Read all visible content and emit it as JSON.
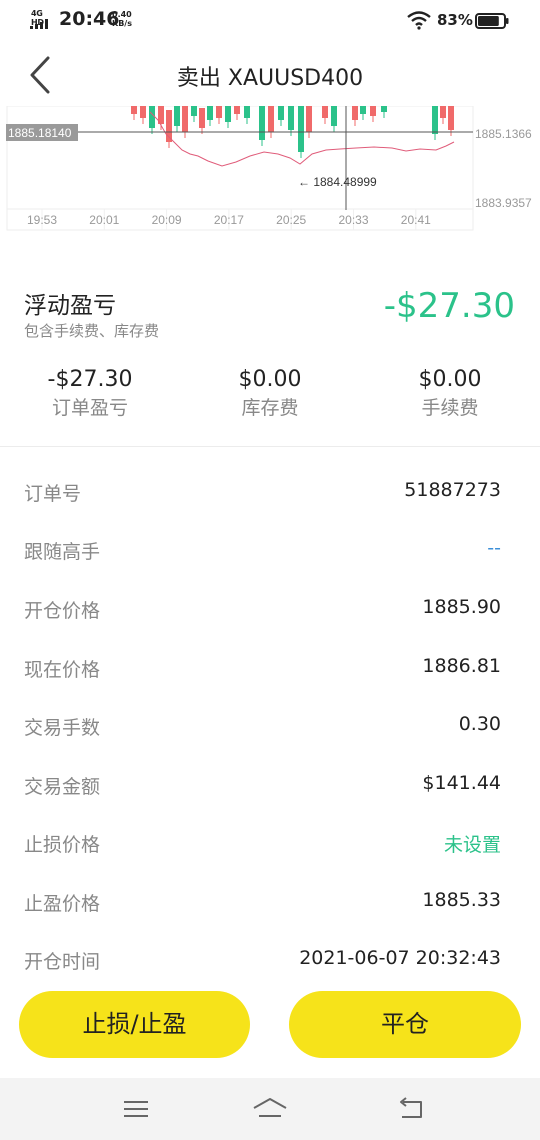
{
  "status_bar": {
    "network": "4G HD",
    "time": "20:46",
    "speed_value": "0.40",
    "speed_unit": "KB/s",
    "battery_percent": "83%",
    "battery_level": 0.83
  },
  "header": {
    "title": "卖出 XAUUSD400"
  },
  "chart": {
    "left_price_label": "1885.18140",
    "right_price_label_top": "1885.1366",
    "right_price_label_bottom": "1883.9357",
    "marker_label": "← 1884.48999",
    "time_labels": [
      "19:53",
      "20:01",
      "20:09",
      "20:17",
      "20:25",
      "20:33",
      "20:41"
    ],
    "up_color": "#2bc28a",
    "down_color": "#f06a6a",
    "line_color": "#e05c7a"
  },
  "summary": {
    "title": "浮动盈亏",
    "subtitle": "包含手续费、库存费",
    "value": "-$27.30",
    "value_color": "#2bc28a",
    "stats": [
      {
        "value": "-$27.30",
        "label": "订单盈亏"
      },
      {
        "value": "$0.00",
        "label": "库存费"
      },
      {
        "value": "$0.00",
        "label": "手续费"
      }
    ]
  },
  "details": [
    {
      "key": "订单号",
      "value": "51887273"
    },
    {
      "key": "跟随高手",
      "value": "--"
    },
    {
      "key": "开仓价格",
      "value": "1885.90"
    },
    {
      "key": "现在价格",
      "value": "1886.81"
    },
    {
      "key": "交易手数",
      "value": "0.30"
    },
    {
      "key": "交易金额",
      "value": "$141.44"
    },
    {
      "key": "止损价格",
      "value": "未设置"
    },
    {
      "key": "止盈价格",
      "value": "1885.33"
    },
    {
      "key": "开仓时间",
      "value": "2021-06-07 20:32:43"
    }
  ],
  "actions": {
    "stop_label": "止损/止盈",
    "close_label": "平仓",
    "button_color": "#f6e31a"
  },
  "nav": {
    "icons": [
      "menu-icon",
      "home-icon",
      "back-icon"
    ]
  }
}
